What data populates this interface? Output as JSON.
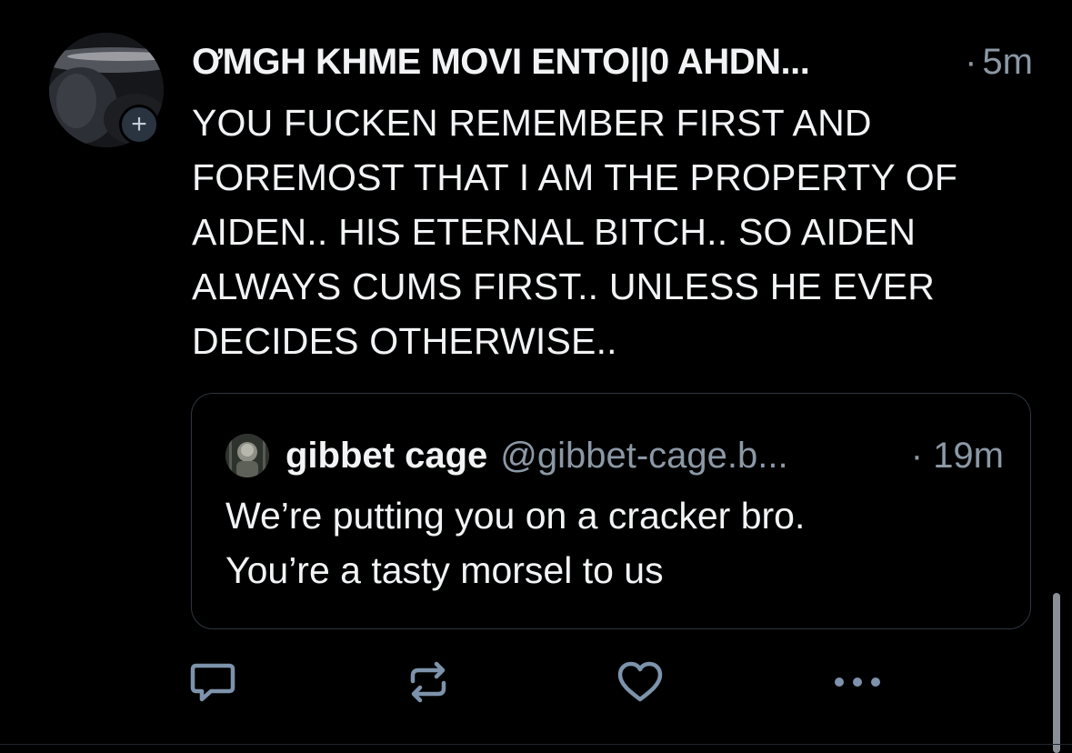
{
  "post": {
    "author_display_name": "ƠMGH KHME MOVI ENTO||0 AHDN...",
    "time_ago": "5m",
    "time_separator": "·",
    "follow_badge": "+",
    "text": "YOU FUCKEN REMEMBER FIRST AND\nFOREMOST THAT I AM THE PROPERTY OF\nAIDEN.. HIS ETERNAL BITCH.. SO AIDEN\nALWAYS CUMS FIRST.. UNLESS HE EVER\nDECIDES OTHERWISE..",
    "quote": {
      "author_name": "gibbet cage",
      "author_handle": "@gibbet-cage.b...",
      "time_ago": "19m",
      "time_separator": "·",
      "text": "We’re putting you on a cracker bro.\nYou’re a tasty morsel to us"
    },
    "actions": [
      {
        "name": "reply",
        "icon": "reply-icon"
      },
      {
        "name": "repost",
        "icon": "repost-icon"
      },
      {
        "name": "like",
        "icon": "heart-icon"
      },
      {
        "name": "more",
        "icon": "more-icon"
      }
    ]
  },
  "colors": {
    "background": "#000000",
    "primary_text": "#f1f3f5",
    "secondary_text": "#8b98a5",
    "icon": "#7d93ab",
    "border": "#2e3640"
  }
}
